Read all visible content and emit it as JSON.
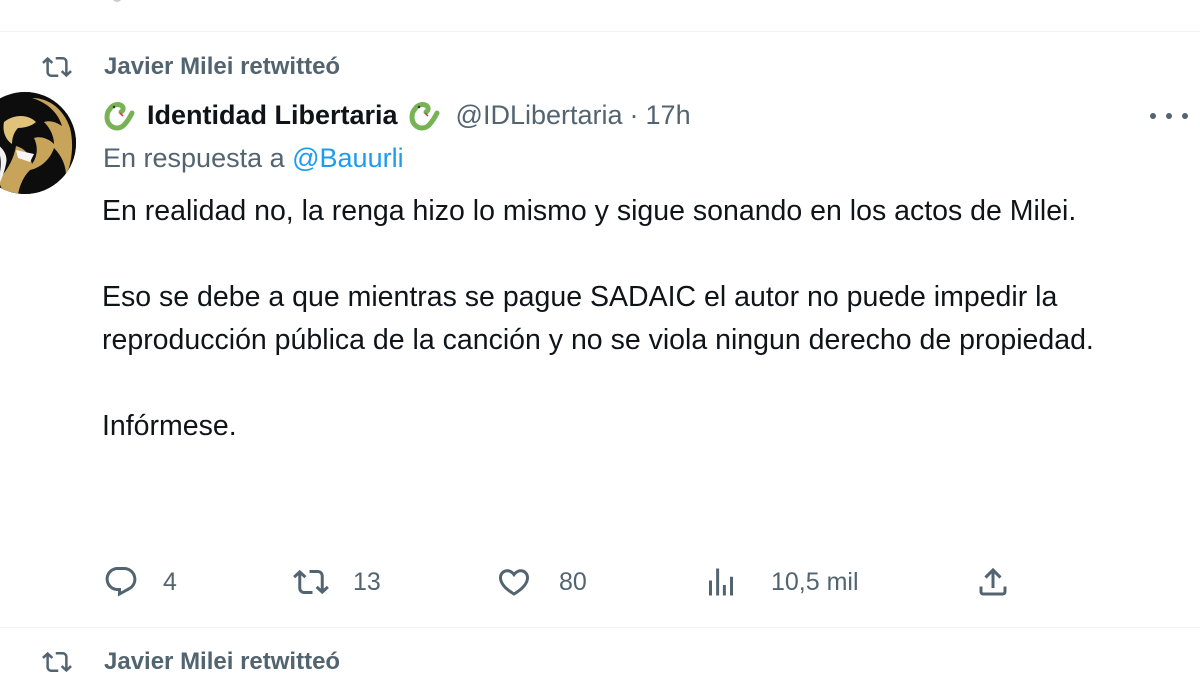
{
  "retweet_banner": {
    "icon": "retweet-icon",
    "text": "Javier Milei retwitteó"
  },
  "tweet": {
    "author": {
      "name": "Identidad Libertaria",
      "handle": "@IDLibertaria",
      "separator": "·",
      "time": "17h",
      "name_emoji": "snake-emoji"
    },
    "reply": {
      "prefix": "En respuesta a ",
      "mention": "@Bauurli"
    },
    "paragraphs": [
      "En realidad no, la renga hizo lo mismo y sigue sonando en los actos de Milei.",
      "Eso se debe a que mientras se pague SADAIC el autor no puede impedir la reproducción pública de la canción y no se viola ningun derecho de propiedad.",
      "Infórmese."
    ],
    "actions": {
      "replies": "4",
      "retweets": "13",
      "likes": "80",
      "views": "10,5 mil"
    }
  },
  "next_retweet_banner": {
    "text": "Javier Milei retwitteó"
  },
  "colors": {
    "text": "#0f1419",
    "secondary": "#536471",
    "link": "#1d9bf0",
    "divider": "#eff3f4",
    "snake_green": "#77b255"
  }
}
